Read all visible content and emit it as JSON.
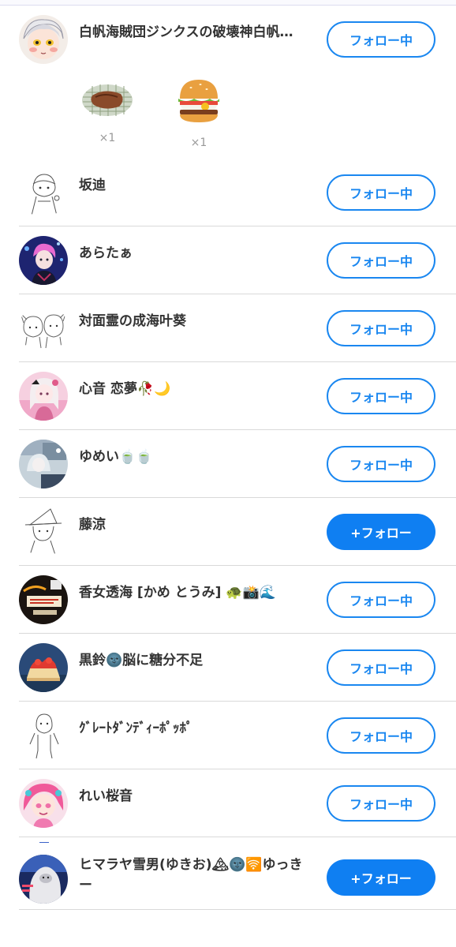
{
  "users": [
    {
      "name": "白帆海賊団ジンクスの破壊神白帆…",
      "button": "フォロー中",
      "following": true,
      "avatar": "anime-girl-avatar"
    },
    {
      "name": "坂迪",
      "button": "フォロー中",
      "following": true,
      "avatar": "sketch-avatar"
    },
    {
      "name": "あらたぁ",
      "button": "フォロー中",
      "following": true,
      "avatar": "anime-boy-avatar"
    },
    {
      "name": "対面霊の成海叶葵",
      "button": "フォロー中",
      "following": true,
      "avatar": "sketch-pair-avatar"
    },
    {
      "name": "心音 恋夢🥀🌙",
      "button": "フォロー中",
      "following": true,
      "avatar": "pink-girl-avatar"
    },
    {
      "name": "ゆめい🍵🍵",
      "button": "フォロー中",
      "following": true,
      "avatar": "poster-avatar"
    },
    {
      "name": "藤涼",
      "button": "+フォロー",
      "following": false,
      "avatar": "witch-sketch-avatar"
    },
    {
      "name": "香女透海 [かめ とうみ] 🐢📸🌊",
      "button": "フォロー中",
      "following": true,
      "avatar": "dark-poster-avatar"
    },
    {
      "name": "黒鈴🌚脳に糖分不足",
      "button": "フォロー中",
      "following": true,
      "avatar": "cake-avatar"
    },
    {
      "name": "ｸﾞﾚｰﾄﾀﾞﾝﾃﾞｨｰﾎﾟｯﾎﾟ",
      "button": "フォロー中",
      "following": true,
      "avatar": "standing-sketch-avatar"
    },
    {
      "name": "れい桜音",
      "button": "フォロー中",
      "following": true,
      "avatar": "pink-hair-avatar"
    },
    {
      "name": "ヒマラヤ雪男(ゆきお)🏔🌚🛜ゆっきー",
      "button": "+フォロー",
      "following": false,
      "avatar": "yeti-avatar"
    }
  ],
  "gifts": [
    {
      "name": "grilled-meat-icon",
      "count": "×1"
    },
    {
      "name": "hamburger-icon",
      "count": "×1"
    }
  ],
  "colors": {
    "accent": "#1a87f0",
    "follow_fill": "#0f7ff2",
    "divider": "#d9d9d9",
    "text": "#333333"
  }
}
